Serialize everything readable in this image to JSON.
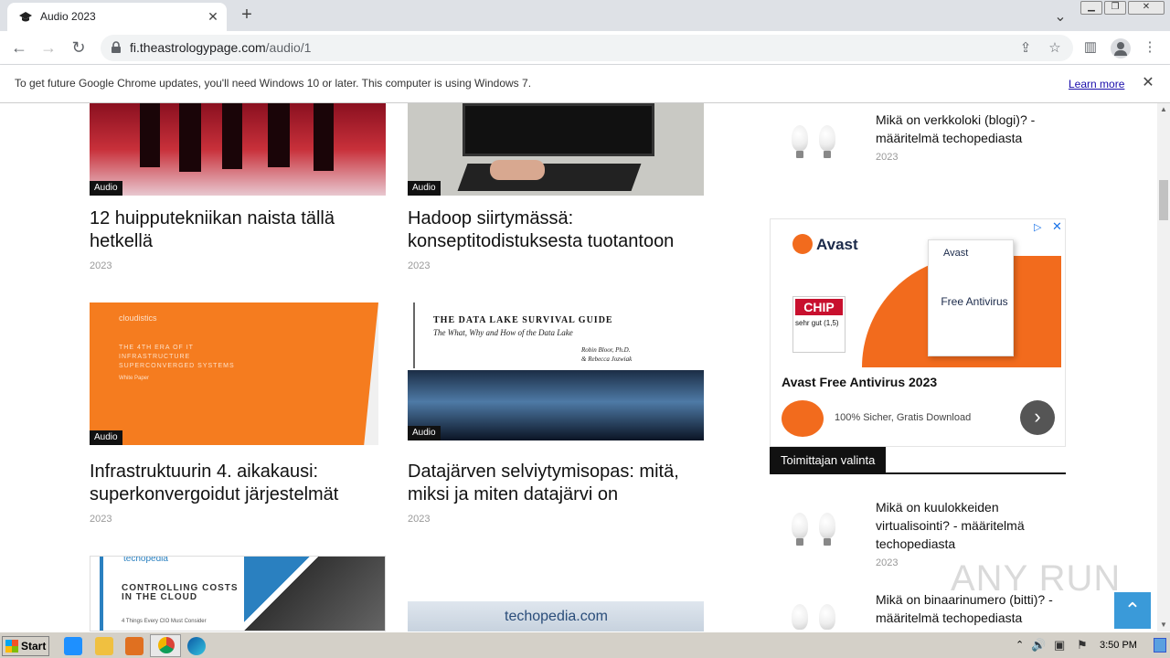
{
  "browser": {
    "tab_title": "Audio 2023",
    "url_host": "fi.theastrologypage.com",
    "url_path": "/audio/1"
  },
  "infobar": {
    "message": "To get future Google Chrome updates, you'll need Windows 10 or later. This computer is using Windows 7.",
    "learn_more": "Learn more"
  },
  "articles": [
    {
      "badge": "Audio",
      "title": "12 huipputekniikan naista tällä hetkellä",
      "year": "2023"
    },
    {
      "badge": "Audio",
      "title": "Hadoop siirtymässä: konseptitodistuksesta tuotantoon",
      "year": "2023"
    },
    {
      "badge": "Audio",
      "title": "Infrastruktuurin 4. aikakausi: superkonvergoidut järjestelmät",
      "year": "2023"
    },
    {
      "badge": "Audio",
      "title": "Datajärven selviytymisopas: mitä, miksi ja miten datajärvi on",
      "year": "2023"
    }
  ],
  "thumb_text": {
    "cloudistics_logo": "cloudistics",
    "cloudistics_line1": "THE 4TH ERA OF IT",
    "cloudistics_line2": "INFRASTRUCTURE",
    "cloudistics_line3": "SUPERCONVERGED SYSTEMS",
    "cloudistics_line4": "White Paper",
    "datalake_title": "THE DATA LAKE SURVIVAL GUIDE",
    "datalake_sub": "The What, Why and How of the Data Lake",
    "datalake_author1": "Robin Bloor, Ph.D.",
    "datalake_author2": "& Rebecca Jozwiak",
    "techopedia_small": "techopedia",
    "controlling_title": "CONTROLLING COSTS IN THE CLOUD",
    "controlling_sub": "4 Things Every CIO Must Consider",
    "techopedia_banner": "techopedia.com"
  },
  "sidebar": {
    "top_item": {
      "title": "Mikä on verkkoloki (blogi)? - määritelmä techopediasta",
      "year": "2023"
    },
    "ad": {
      "brand": "Avast",
      "box_brand": "Avast",
      "box_text": "Free Antivirus",
      "chip": "CHIP",
      "chip_rating": "sehr gut (1,5)",
      "title": "Avast Free Antivirus 2023",
      "subtitle": "100% Sicher, Gratis Download"
    },
    "section_title": "Toimittajan valinta",
    "items": [
      {
        "title": "Mikä on kuulokkeiden virtualisointi? - määritelmä techopediasta",
        "year": "2023"
      },
      {
        "title": "Mikä on binaarinumero (bitti)? - määritelmä techopediasta",
        "year": ""
      }
    ]
  },
  "watermark": "ANY RUN",
  "taskbar": {
    "start_label": "Start",
    "clock": "3:50 PM"
  }
}
